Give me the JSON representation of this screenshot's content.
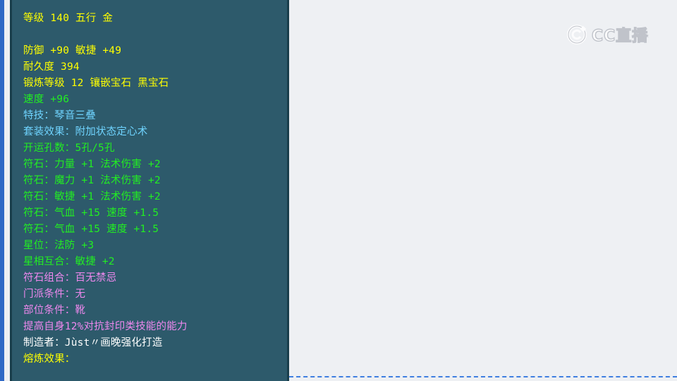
{
  "item_tooltip": {
    "lines": [
      {
        "text": "等级 140 五行 金",
        "color": "#ffff00"
      },
      {
        "text": "",
        "color": ""
      },
      {
        "text": "防御 +90 敏捷 +49",
        "color": "#ffff00"
      },
      {
        "text": "耐久度 394",
        "color": "#ffff00"
      },
      {
        "text": "锻炼等级 12 镶嵌宝石 黑宝石",
        "color": "#ffff00"
      },
      {
        "text": "速度 +96",
        "color": "#22ee22"
      },
      {
        "text": "特技：琴音三叠",
        "color": "#6fd4ff"
      },
      {
        "text": "套装效果：附加状态定心术",
        "color": "#6fd4ff"
      },
      {
        "text": "开运孔数：5孔/5孔",
        "color": "#22ee22"
      },
      {
        "text": "符石：力量 +1 法术伤害 +2",
        "color": "#22ee22"
      },
      {
        "text": "符石：魔力 +1 法术伤害 +2",
        "color": "#22ee22"
      },
      {
        "text": "符石：敏捷 +1 法术伤害 +2",
        "color": "#22ee22"
      },
      {
        "text": "符石：气血 +15 速度 +1.5",
        "color": "#22ee22"
      },
      {
        "text": "符石：气血 +15 速度 +1.5",
        "color": "#22ee22"
      },
      {
        "text": "星位：法防 +3",
        "color": "#22ee22"
      },
      {
        "text": "星相互合：敏捷 +2",
        "color": "#22ee22"
      },
      {
        "text": "符石组合：百无禁忌",
        "color": "#ee88ee"
      },
      {
        "text": "门派条件：无",
        "color": "#ee88ee"
      },
      {
        "text": "部位条件：靴",
        "color": "#ee88ee"
      },
      {
        "text": "提高自身12%对抗封印类技能的能力",
        "color": "#ee88ee"
      },
      {
        "text": "制造者：Jùst〃画晚强化打造",
        "color": "#ffffff"
      },
      {
        "text": "熔炼效果：",
        "color": "#ffff00"
      }
    ]
  },
  "watermark": {
    "text": "CC直播",
    "icon": "cc-logo-icon"
  },
  "colors": {
    "panel_bg": "#2d5a6b",
    "page_bg": "#eef0f3",
    "accent_blue": "#2f69c5"
  }
}
